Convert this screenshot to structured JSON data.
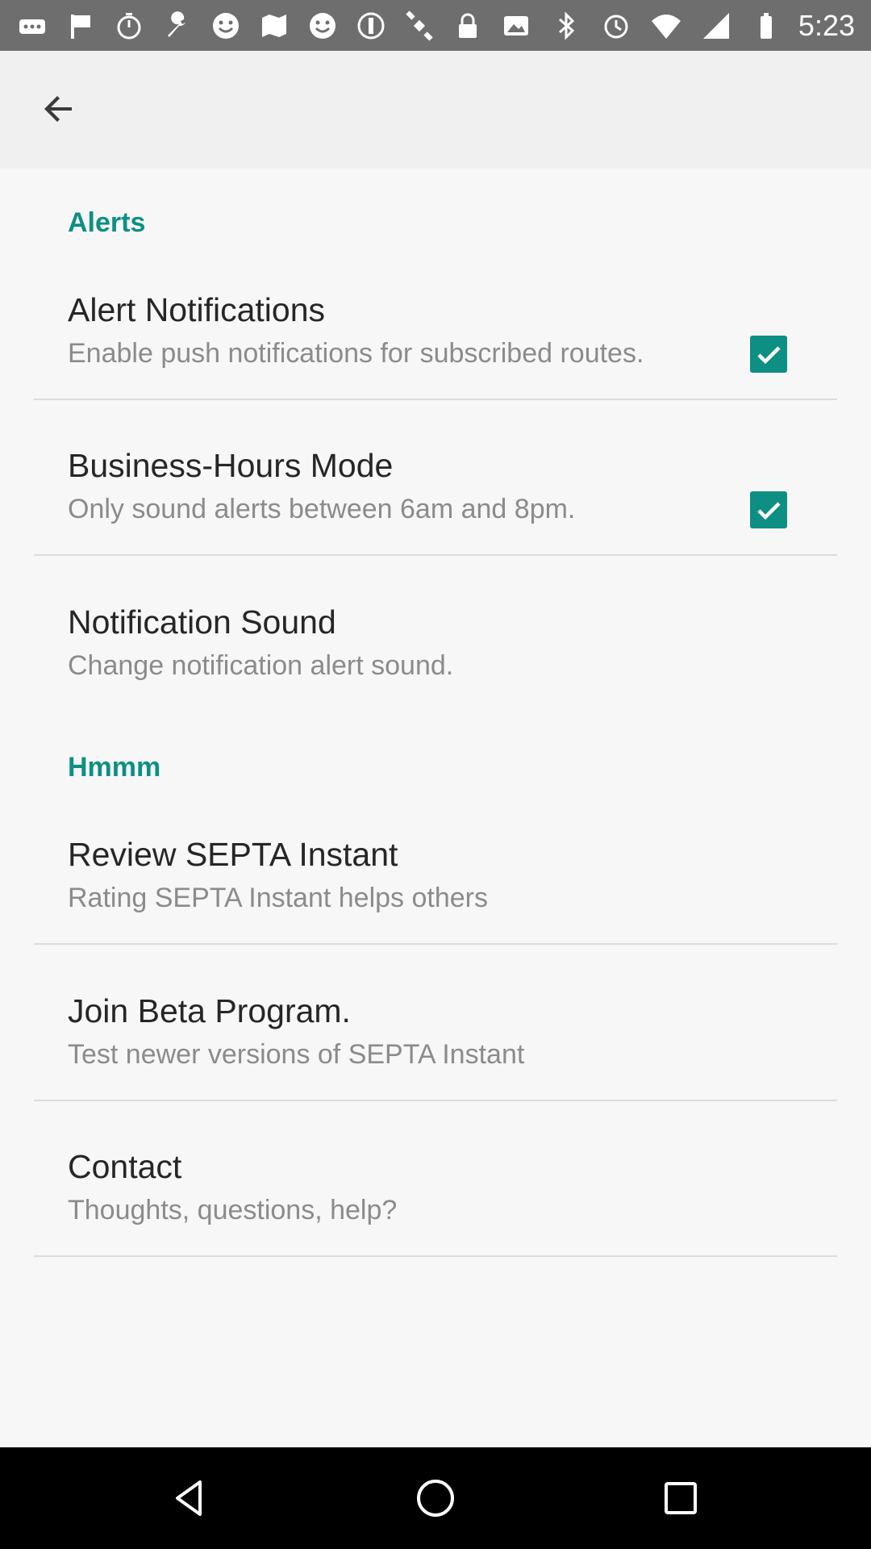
{
  "status_bar": {
    "time": "5:23",
    "left_icons": [
      "more-icon",
      "flag-icon",
      "timer-icon",
      "wrench-icon",
      "smiley-icon",
      "map-icon",
      "smiley-icon",
      "disc-icon",
      "satellite-icon",
      "lock-icon",
      "image-icon"
    ],
    "right_icons": [
      "bluetooth-icon",
      "alarm-icon",
      "wifi-icon",
      "signal-icon",
      "battery-icon"
    ]
  },
  "toolbar": {
    "back_icon": "arrow-back-icon"
  },
  "sections": {
    "alerts_header": "Alerts",
    "hmmm_header": "Hmmm"
  },
  "prefs": {
    "alert_notifications": {
      "title": "Alert Notifications",
      "summary": "Enable push notifications for subscribed routes.",
      "checked": true
    },
    "business_hours": {
      "title": "Business-Hours Mode",
      "summary": "Only sound alerts between 6am and 8pm.",
      "checked": true
    },
    "notification_sound": {
      "title": "Notification Sound",
      "summary": "Change notification alert sound."
    },
    "review": {
      "title": "Review SEPTA Instant",
      "summary": "Rating SEPTA Instant helps others"
    },
    "beta": {
      "title": "Join Beta Program.",
      "summary": "Test newer versions of SEPTA Instant"
    },
    "contact": {
      "title": "Contact",
      "summary": "Thoughts, questions, help?"
    }
  },
  "colors": {
    "accent": "#0e8f83",
    "status_bar": "#6e6e6e",
    "nav_bar": "#000000"
  },
  "nav_bar": {
    "icons": [
      "back-triangle-icon",
      "home-circle-icon",
      "recents-square-icon"
    ]
  }
}
